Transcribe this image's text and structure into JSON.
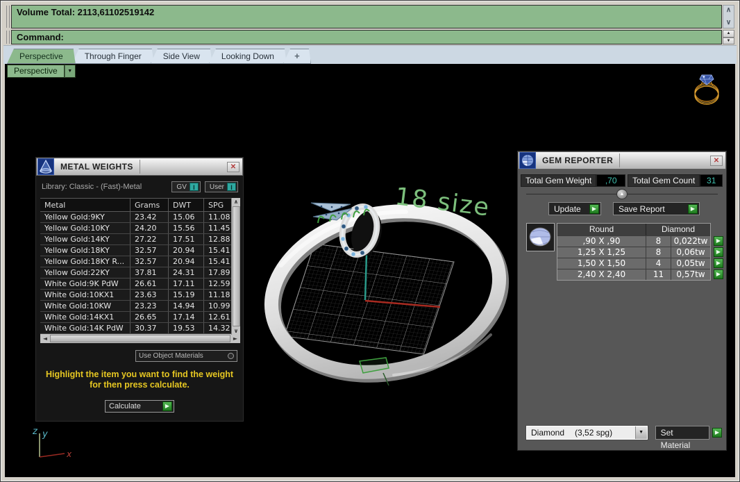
{
  "header": {
    "volume_total": "Volume Total: 2113,61102519142",
    "command_label": "Command:"
  },
  "tabs": {
    "items": [
      {
        "label": "Perspective",
        "active": true
      },
      {
        "label": "Through Finger"
      },
      {
        "label": "Side View"
      },
      {
        "label": "Looking Down"
      }
    ],
    "add_label": "+"
  },
  "viewport": {
    "label": "Perspective",
    "scene_text": "18 size",
    "axis_x": "x",
    "axis_y": "y",
    "axis_z": "z"
  },
  "metal_weights": {
    "title": "METAL WEIGHTS",
    "library_label": "Library: Classic - (Fast)-Metal",
    "gv_button": "GV",
    "user_button": "User",
    "columns": [
      "Metal",
      "Grams",
      "DWT",
      "SPG"
    ],
    "rows": [
      {
        "metal": "Yellow Gold:9KY",
        "grams": "23.42",
        "dwt": "15.06",
        "spg": "11.08"
      },
      {
        "metal": "Yellow Gold:10KY",
        "grams": "24.20",
        "dwt": "15.56",
        "spg": "11.45"
      },
      {
        "metal": "Yellow Gold:14KY",
        "grams": "27.22",
        "dwt": "17.51",
        "spg": "12.88"
      },
      {
        "metal": "Yellow Gold:18KY",
        "grams": "32.57",
        "dwt": "20.94",
        "spg": "15.41"
      },
      {
        "metal": "Yellow Gold:18KY R...",
        "grams": "32.57",
        "dwt": "20.94",
        "spg": "15.41"
      },
      {
        "metal": "Yellow Gold:22KY",
        "grams": "37.81",
        "dwt": "24.31",
        "spg": "17.89"
      },
      {
        "metal": "White Gold:9K PdW",
        "grams": "26.61",
        "dwt": "17.11",
        "spg": "12.59"
      },
      {
        "metal": "White Gold:10KX1",
        "grams": "23.63",
        "dwt": "15.19",
        "spg": "11.18"
      },
      {
        "metal": "White Gold:10KW",
        "grams": "23.23",
        "dwt": "14.94",
        "spg": "10.99"
      },
      {
        "metal": "White Gold:14KX1",
        "grams": "26.65",
        "dwt": "17.14",
        "spg": "12.61"
      },
      {
        "metal": "White Gold:14K PdW",
        "grams": "30.37",
        "dwt": "19.53",
        "spg": "14.32"
      }
    ],
    "materials_dropdown": "Use Object Materials",
    "hint_line1": "Highlight the item you want to find the weight",
    "hint_line2": "for then press calculate.",
    "calculate_button": "Calculate"
  },
  "gem_reporter": {
    "title": "GEM REPORTER",
    "total_weight_label": "Total Gem Weight",
    "total_weight_value": ",70",
    "total_count_label": "Total Gem Count",
    "total_count_value": "31",
    "update_button": "Update",
    "save_report_button": "Save Report",
    "columns": [
      "Round",
      "Diamond"
    ],
    "rows": [
      {
        "size": ",90 X ,90",
        "count": "8",
        "weight": "0,022tw"
      },
      {
        "size": "1,25 X 1,25",
        "count": "8",
        "weight": "0,06tw"
      },
      {
        "size": "1,50 X 1,50",
        "count": "4",
        "weight": "0,05tw"
      },
      {
        "size": "2,40 X 2,40",
        "count": "11",
        "weight": "0,57tw"
      }
    ],
    "material_name": "Diamond",
    "material_spg": "(3,52 spg)",
    "set_material_button": "Set Material"
  },
  "icons": {
    "close": "✕",
    "play": "▶",
    "up_arrow": "▲",
    "down_arrow": "▼",
    "left_arrow": "◄",
    "right_arrow": "►",
    "chevron_up": "∧",
    "chevron_down": "∨",
    "dropdown_arrow": "▼",
    "info": "I"
  },
  "colors": {
    "accent_green": "#8cb98c",
    "button_green": "#2f8f2f",
    "value_teal": "#3fc0ae",
    "hint_yellow": "#e6c722",
    "scene_text_green": "#7cbf7c",
    "gold": "#d89a28",
    "axis_x_red": "#b84038",
    "axis_z_cyan": "#58b8c8",
    "cplane_x_red": "#a82a20",
    "cplane_y_teal": "#2a9a8a"
  }
}
